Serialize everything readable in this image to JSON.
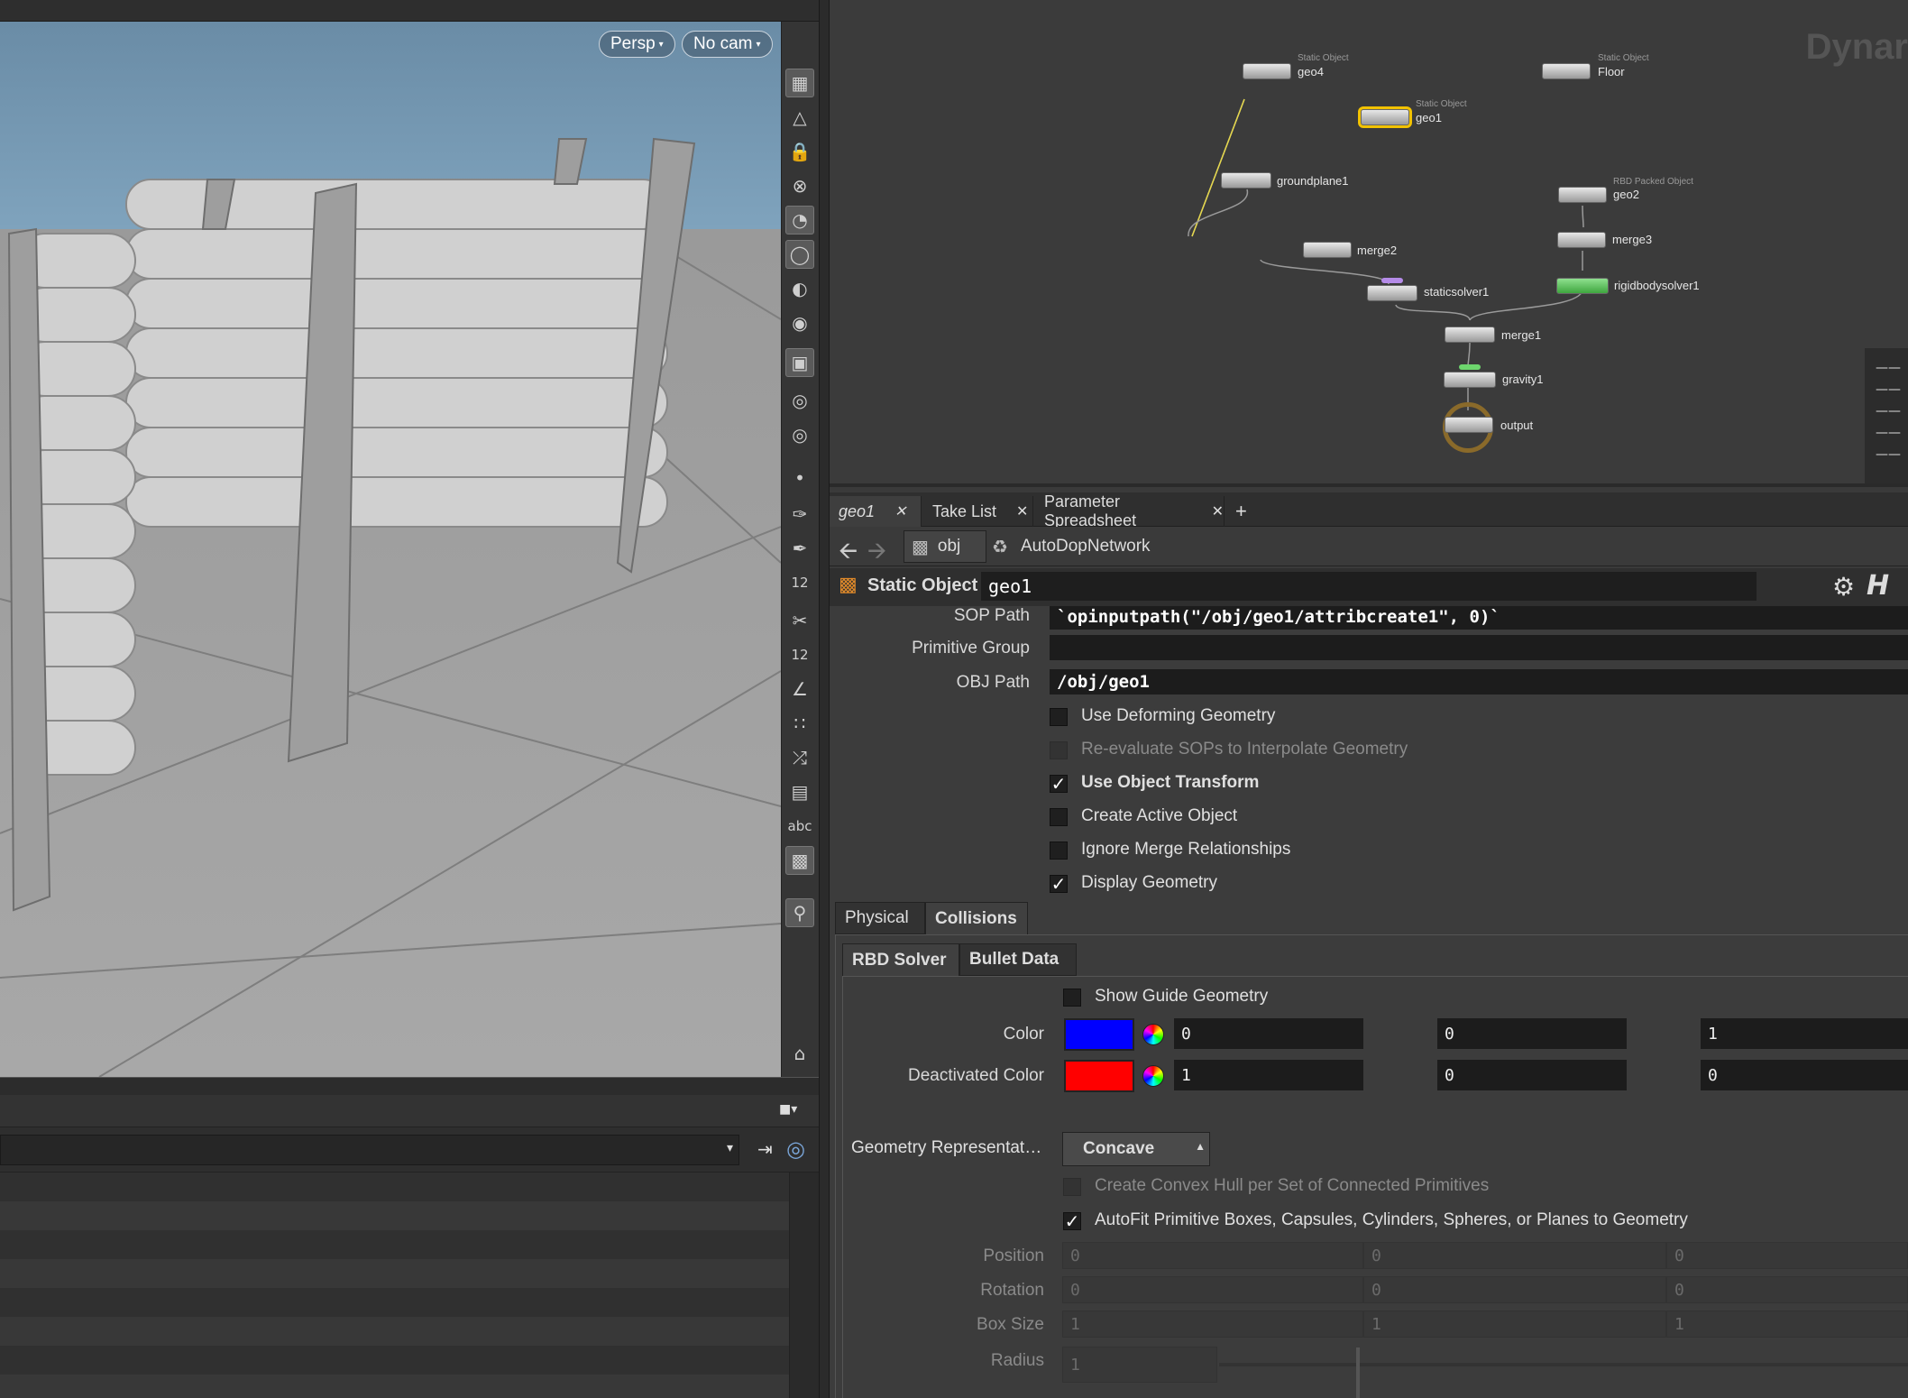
{
  "viewport": {
    "persp_label": "Persp",
    "cam_label": "No cam",
    "toolbar_numbers": [
      "12",
      "12"
    ],
    "toolbar_text": "abc"
  },
  "network": {
    "watermark": "Dynar",
    "nodes": [
      {
        "type": "Static Object",
        "name": "geo4"
      },
      {
        "type": "Static Object",
        "name": "Floor"
      },
      {
        "type": "Static Object",
        "name": "geo1"
      },
      {
        "type": "",
        "name": "groundplane1"
      },
      {
        "type": "RBD Packed Object",
        "name": "geo2"
      },
      {
        "type": "",
        "name": "merge2"
      },
      {
        "type": "",
        "name": "merge3"
      },
      {
        "type": "",
        "name": "staticsolver1"
      },
      {
        "type": "",
        "name": "rigidbodysolver1"
      },
      {
        "type": "",
        "name": "merge1"
      },
      {
        "type": "",
        "name": "gravity1"
      },
      {
        "type": "",
        "name": "output"
      }
    ]
  },
  "tabs": {
    "items": [
      "geo1",
      "Take List",
      "Parameter Spreadsheet"
    ],
    "add": "+"
  },
  "path": {
    "root": "obj",
    "network": "AutoDopNetwork"
  },
  "header": {
    "type_label": "Static Object",
    "node_name": "geo1"
  },
  "params": {
    "sop_path_label": "SOP Path",
    "sop_path_value": "`opinputpath(\"/obj/geo1/attribcreate1\", 0)`",
    "prim_group_label": "Primitive Group",
    "prim_group_value": "",
    "obj_path_label": "OBJ Path",
    "obj_path_value": "/obj/geo1",
    "use_deforming": "Use Deforming Geometry",
    "reevaluate": "Re-evaluate SOPs to Interpolate Geometry",
    "use_obj_xform": "Use Object Transform",
    "create_active": "Create Active Object",
    "ignore_merge": "Ignore Merge Relationships",
    "display_geo": "Display Geometry",
    "tab_physical": "Physical",
    "tab_collisions": "Collisions",
    "subtab_rbd": "RBD Solver",
    "subtab_bullet": "Bullet Data",
    "show_guide": "Show Guide Geometry",
    "color_label": "Color",
    "color_values": [
      "0",
      "0",
      "1"
    ],
    "color_hex": "#0000ff",
    "deact_label": "Deactivated Color",
    "deact_values": [
      "1",
      "0",
      "0"
    ],
    "deact_hex": "#ff0000",
    "georep_label": "Geometry Representat…",
    "georep_value": "Concave",
    "convex_hull": "Create Convex Hull per Set of Connected Primitives",
    "autofit": "AutoFit Primitive Boxes, Capsules, Cylinders, Spheres, or Planes to Geometry",
    "position_label": "Position",
    "position_values": [
      "0",
      "0",
      "0"
    ],
    "rotation_label": "Rotation",
    "rotation_values": [
      "0",
      "0",
      "0"
    ],
    "boxsize_label": "Box Size",
    "boxsize_values": [
      "1",
      "1",
      "1"
    ],
    "radius_label": "Radius",
    "radius_value": "1"
  }
}
